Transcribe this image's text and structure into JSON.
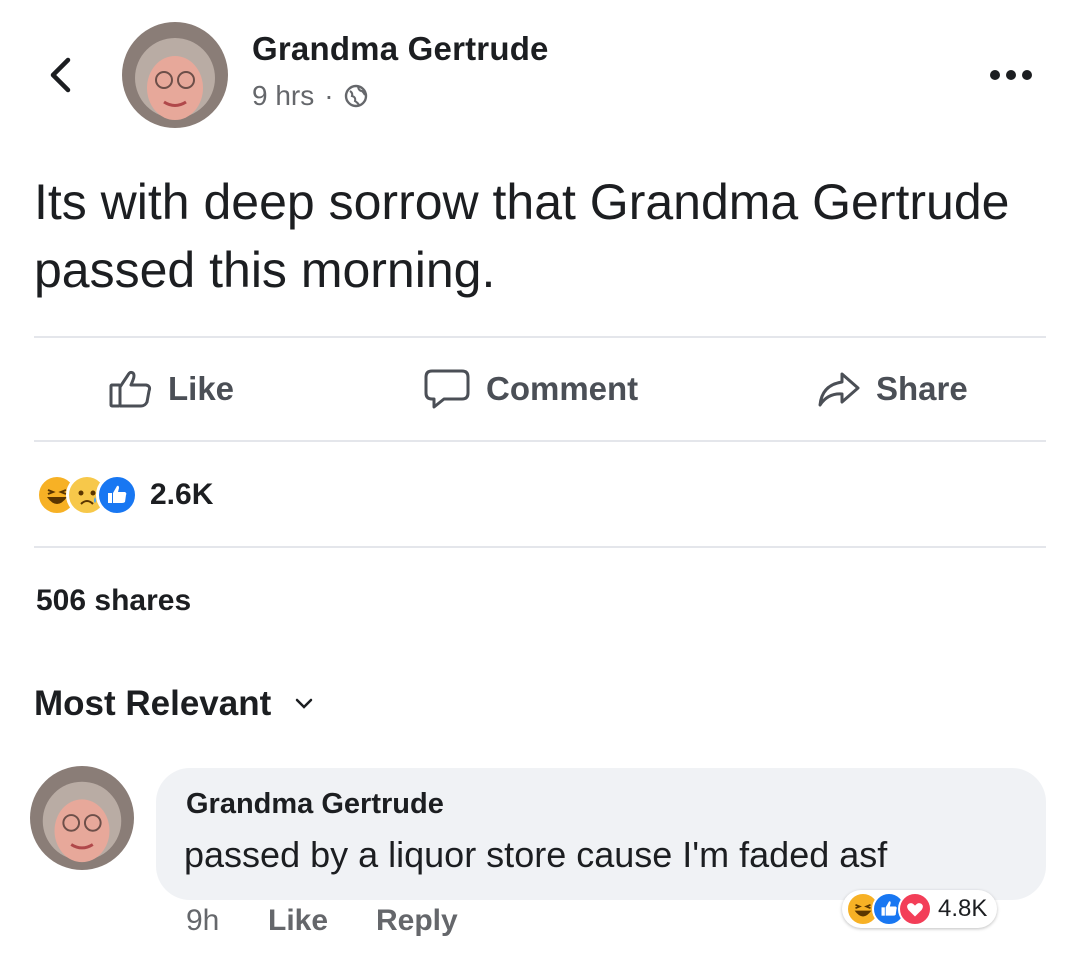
{
  "post": {
    "author": "Grandma Gertrude",
    "time": "9 hrs",
    "separator": "·",
    "privacy_icon": "globe-icon",
    "text": "Its with deep sorrow that Grandma Gertrude passed this morning."
  },
  "actions": {
    "like": "Like",
    "comment": "Comment",
    "share": "Share"
  },
  "reactions": {
    "icons": [
      "haha",
      "sad",
      "like"
    ],
    "count": "2.6K"
  },
  "shares": "506 shares",
  "sort": {
    "label": "Most Relevant"
  },
  "comment": {
    "author": "Grandma Gertrude",
    "text": "passed by a liquor store cause I'm faded asf",
    "time": "9h",
    "like": "Like",
    "reply": "Reply",
    "reaction_icons": [
      "haha",
      "like",
      "love"
    ],
    "reaction_count": "4.8K"
  },
  "colors": {
    "like_blue": "#1877f2",
    "love_red": "#f33e58",
    "haha_yellow": "#f7b125",
    "secondary_text": "#65676b"
  }
}
